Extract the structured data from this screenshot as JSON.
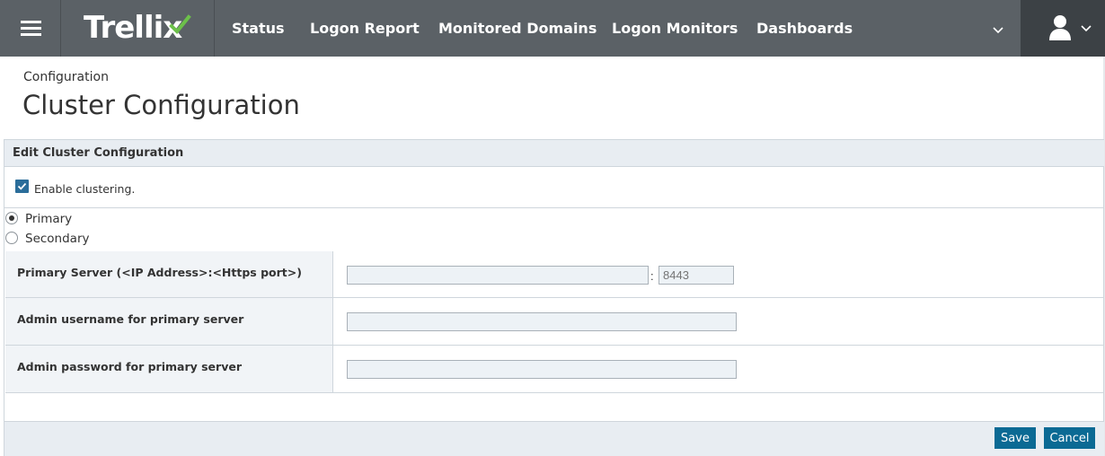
{
  "nav": {
    "brand": "Trellix",
    "items": [
      "Status",
      "Logon Report",
      "Monitored Domains",
      "Logon Monitors",
      "Dashboards"
    ]
  },
  "header": {
    "breadcrumb": "Configuration",
    "title": "Cluster Configuration"
  },
  "panel": {
    "title": "Edit Cluster Configuration",
    "enable_clustering": {
      "label": "Enable clustering.",
      "checked": true
    },
    "role_options": [
      {
        "label": "Primary",
        "selected": true
      },
      {
        "label": "Secondary",
        "selected": false
      }
    ],
    "fields": {
      "primary_server": {
        "label": "Primary Server (<IP Address>:<Https port>)",
        "ip_value": "",
        "separator": ":",
        "port_placeholder": "8443"
      },
      "admin_username": {
        "label": "Admin username for primary server",
        "value": ""
      },
      "admin_password": {
        "label": "Admin password for primary server",
        "value": ""
      }
    }
  },
  "footer": {
    "save_label": "Save",
    "cancel_label": "Cancel"
  },
  "colors": {
    "topbar": "#5b6166",
    "user_area": "#3c4145",
    "accent_button": "#0b6a94",
    "checkbox": "#2b6d9a",
    "logo_mark": "#6cc04a"
  },
  "icons": {
    "menu": "hamburger-menu-icon",
    "more": "chevron-down-icon",
    "user": "user-icon"
  }
}
